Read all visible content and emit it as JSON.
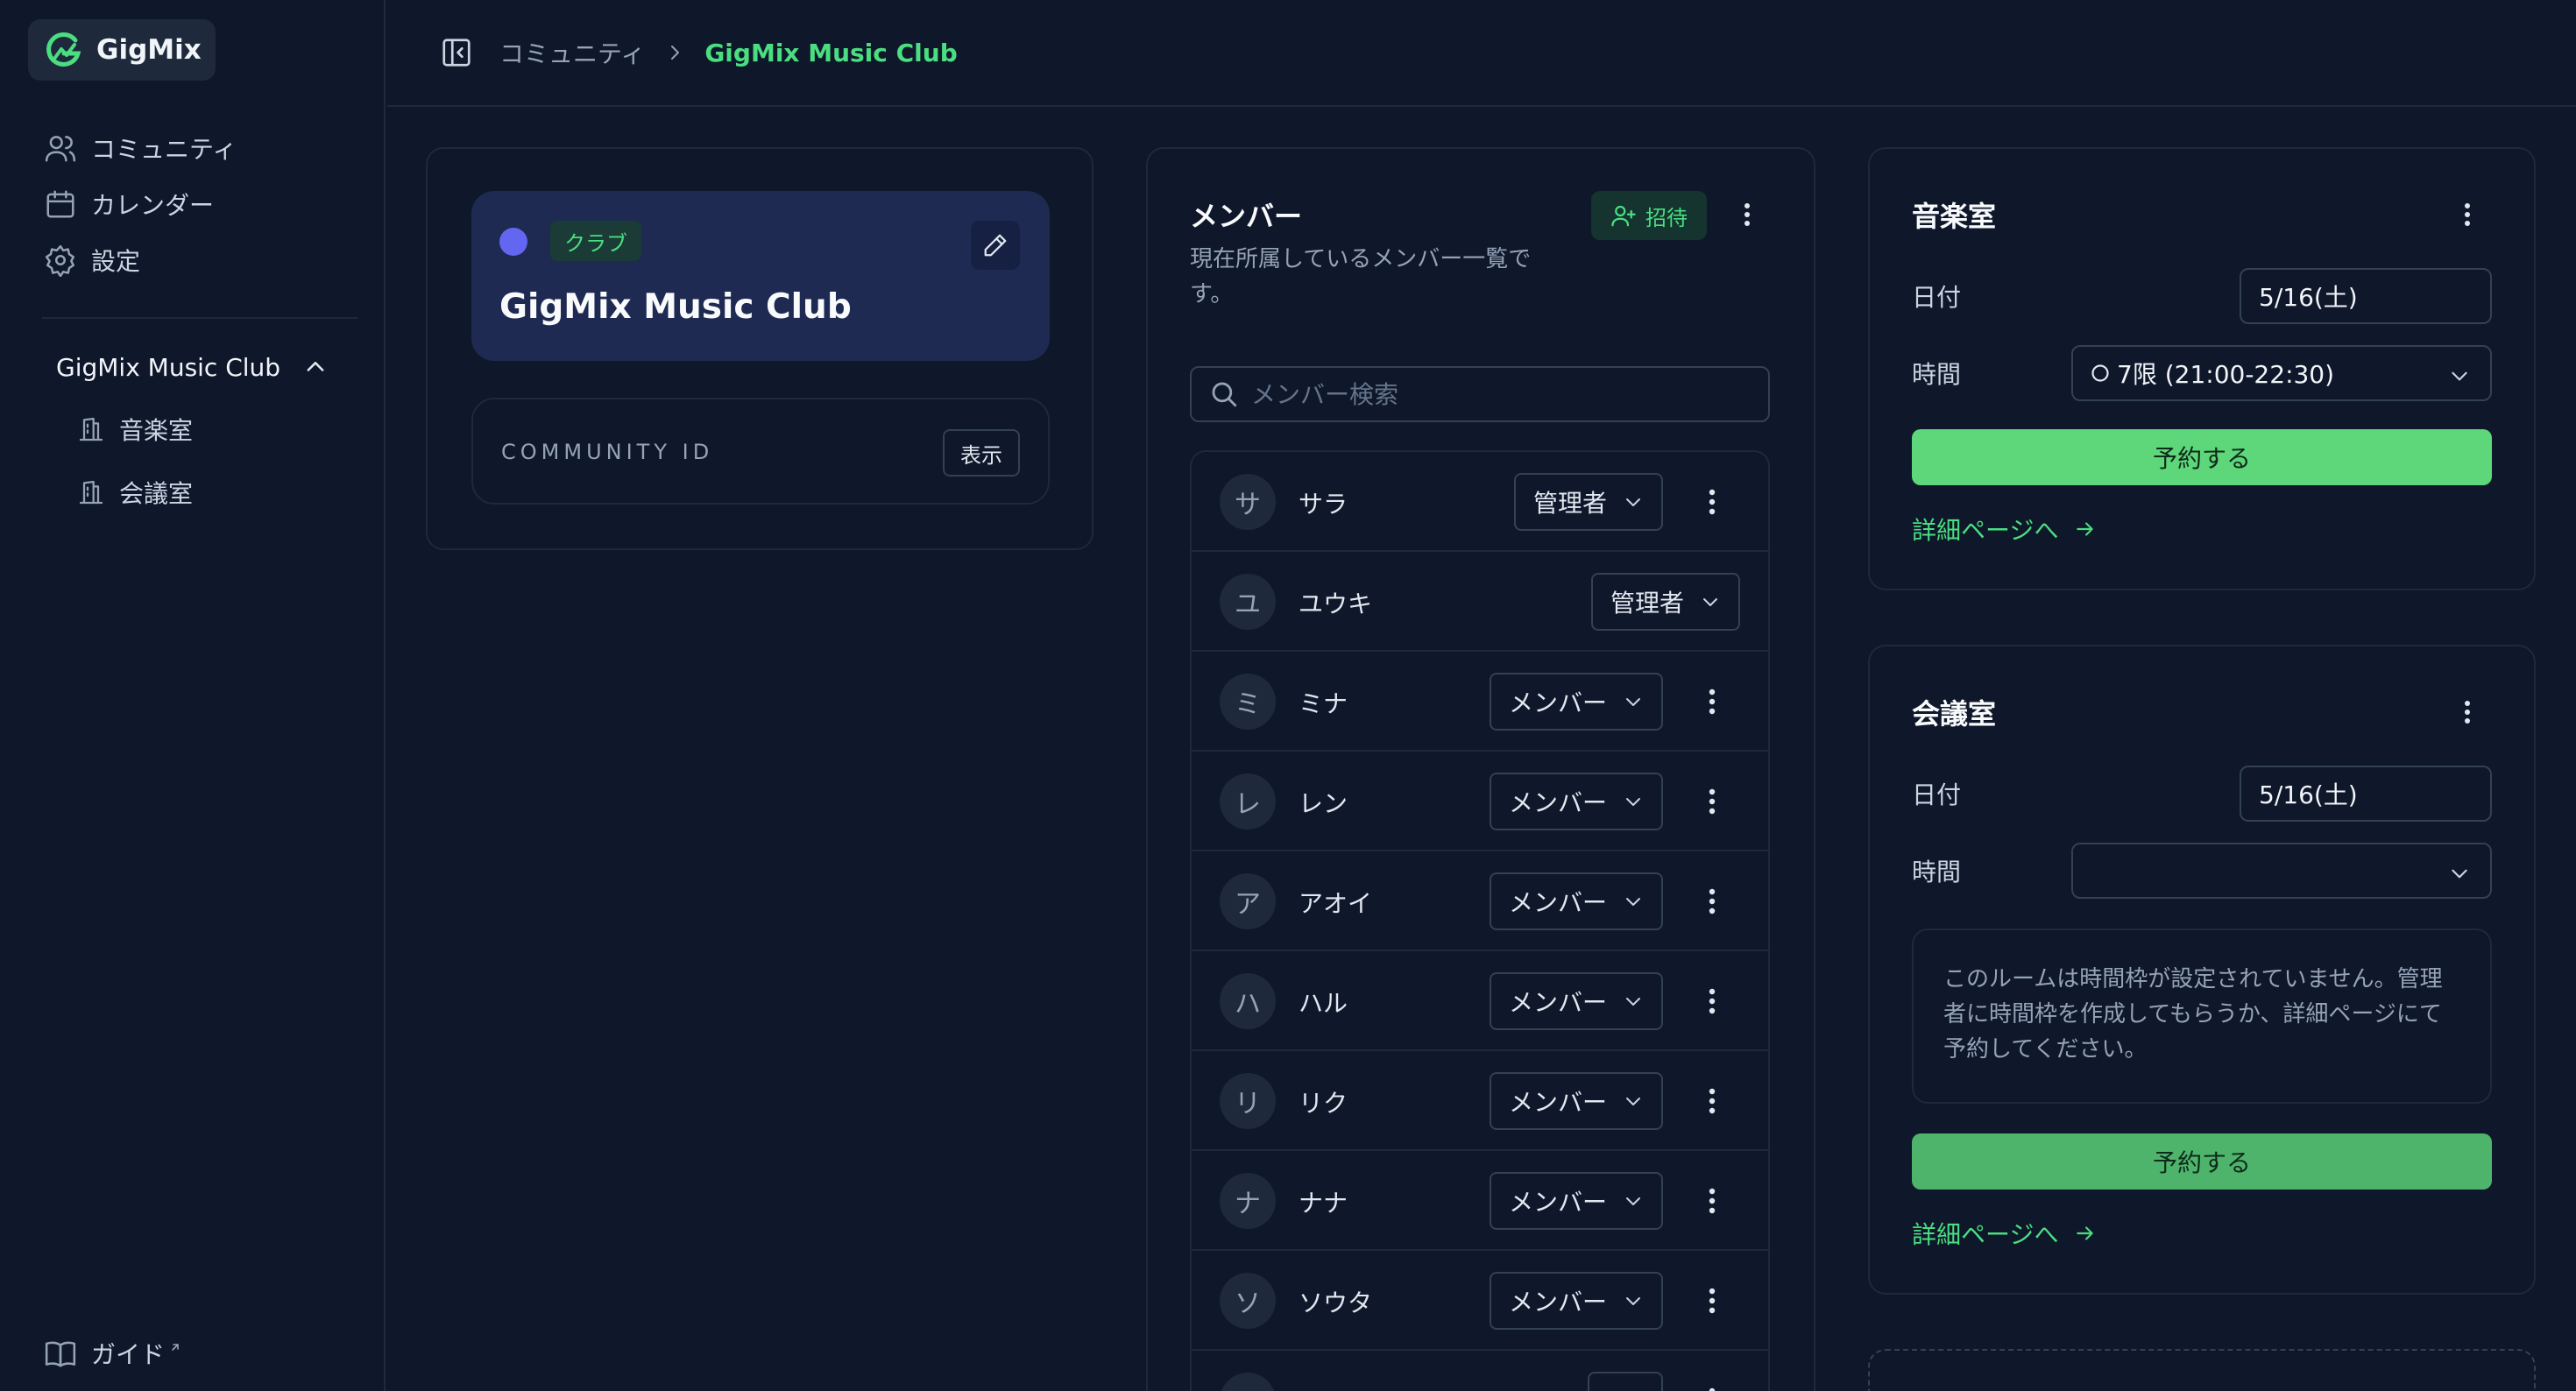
{
  "sidebar": {
    "brand": "GigMix",
    "nav": [
      {
        "label": "コミュニティ",
        "icon": "users-icon"
      },
      {
        "label": "カレンダー",
        "icon": "calendar-icon"
      },
      {
        "label": "設定",
        "icon": "gear-icon"
      }
    ],
    "group": {
      "title": "GigMix Music Club",
      "rooms": [
        {
          "label": "音楽室",
          "icon": "building-icon"
        },
        {
          "label": "会議室",
          "icon": "building-icon"
        }
      ]
    },
    "guide": "ガイド"
  },
  "breadcrumb": {
    "parent": "コミュニティ",
    "current": "GigMix Music Club"
  },
  "club": {
    "tag": "クラブ",
    "name": "GigMix Music Club",
    "dot_color": "#6366f1",
    "community_id_label": "COMMUNITY ID",
    "show_button": "表示"
  },
  "members": {
    "title": "メンバー",
    "description": "現在所属しているメンバー一覧です。",
    "invite_label": "招待",
    "search_placeholder": "メンバー検索",
    "list": [
      {
        "initial": "サ",
        "name": "サラ",
        "role": "管理者",
        "menu": true
      },
      {
        "initial": "ユ",
        "name": "ユウキ",
        "role": "管理者",
        "menu": false
      },
      {
        "initial": "ミ",
        "name": "ミナ",
        "role": "メンバー",
        "menu": true
      },
      {
        "initial": "レ",
        "name": "レン",
        "role": "メンバー",
        "menu": true
      },
      {
        "initial": "ア",
        "name": "アオイ",
        "role": "メンバー",
        "menu": true
      },
      {
        "initial": "ハ",
        "name": "ハル",
        "role": "メンバー",
        "menu": true
      },
      {
        "initial": "リ",
        "name": "リク",
        "role": "メンバー",
        "menu": true
      },
      {
        "initial": "ナ",
        "name": "ナナ",
        "role": "メンバー",
        "menu": true
      },
      {
        "initial": "ソ",
        "name": "ソウタ",
        "role": "メンバー",
        "menu": true
      },
      {
        "initial": "",
        "name": "",
        "role": "",
        "menu": true
      }
    ]
  },
  "rooms": [
    {
      "title": "音楽室",
      "date_label": "日付",
      "date_value": "5/16(土)",
      "time_label": "時間",
      "time_value": "7限 (21:00-22:30)",
      "reserve_label": "予約する",
      "detail_link": "詳細ページへ"
    },
    {
      "title": "会議室",
      "date_label": "日付",
      "date_value": "5/16(土)",
      "time_label": "時間",
      "time_value": "",
      "notice": "このルームは時間枠が設定されていません。管理者に時間枠を作成してもらうか、詳細ページにて予約してください。",
      "reserve_label": "予約する",
      "detail_link": "詳細ページへ"
    }
  ],
  "colors": {
    "background": "#0f172a",
    "accent_green": "#4ade80",
    "button_green": "#5ed67a",
    "button_green_dim": "#4fb46b",
    "club_card": "#1e2a52"
  }
}
